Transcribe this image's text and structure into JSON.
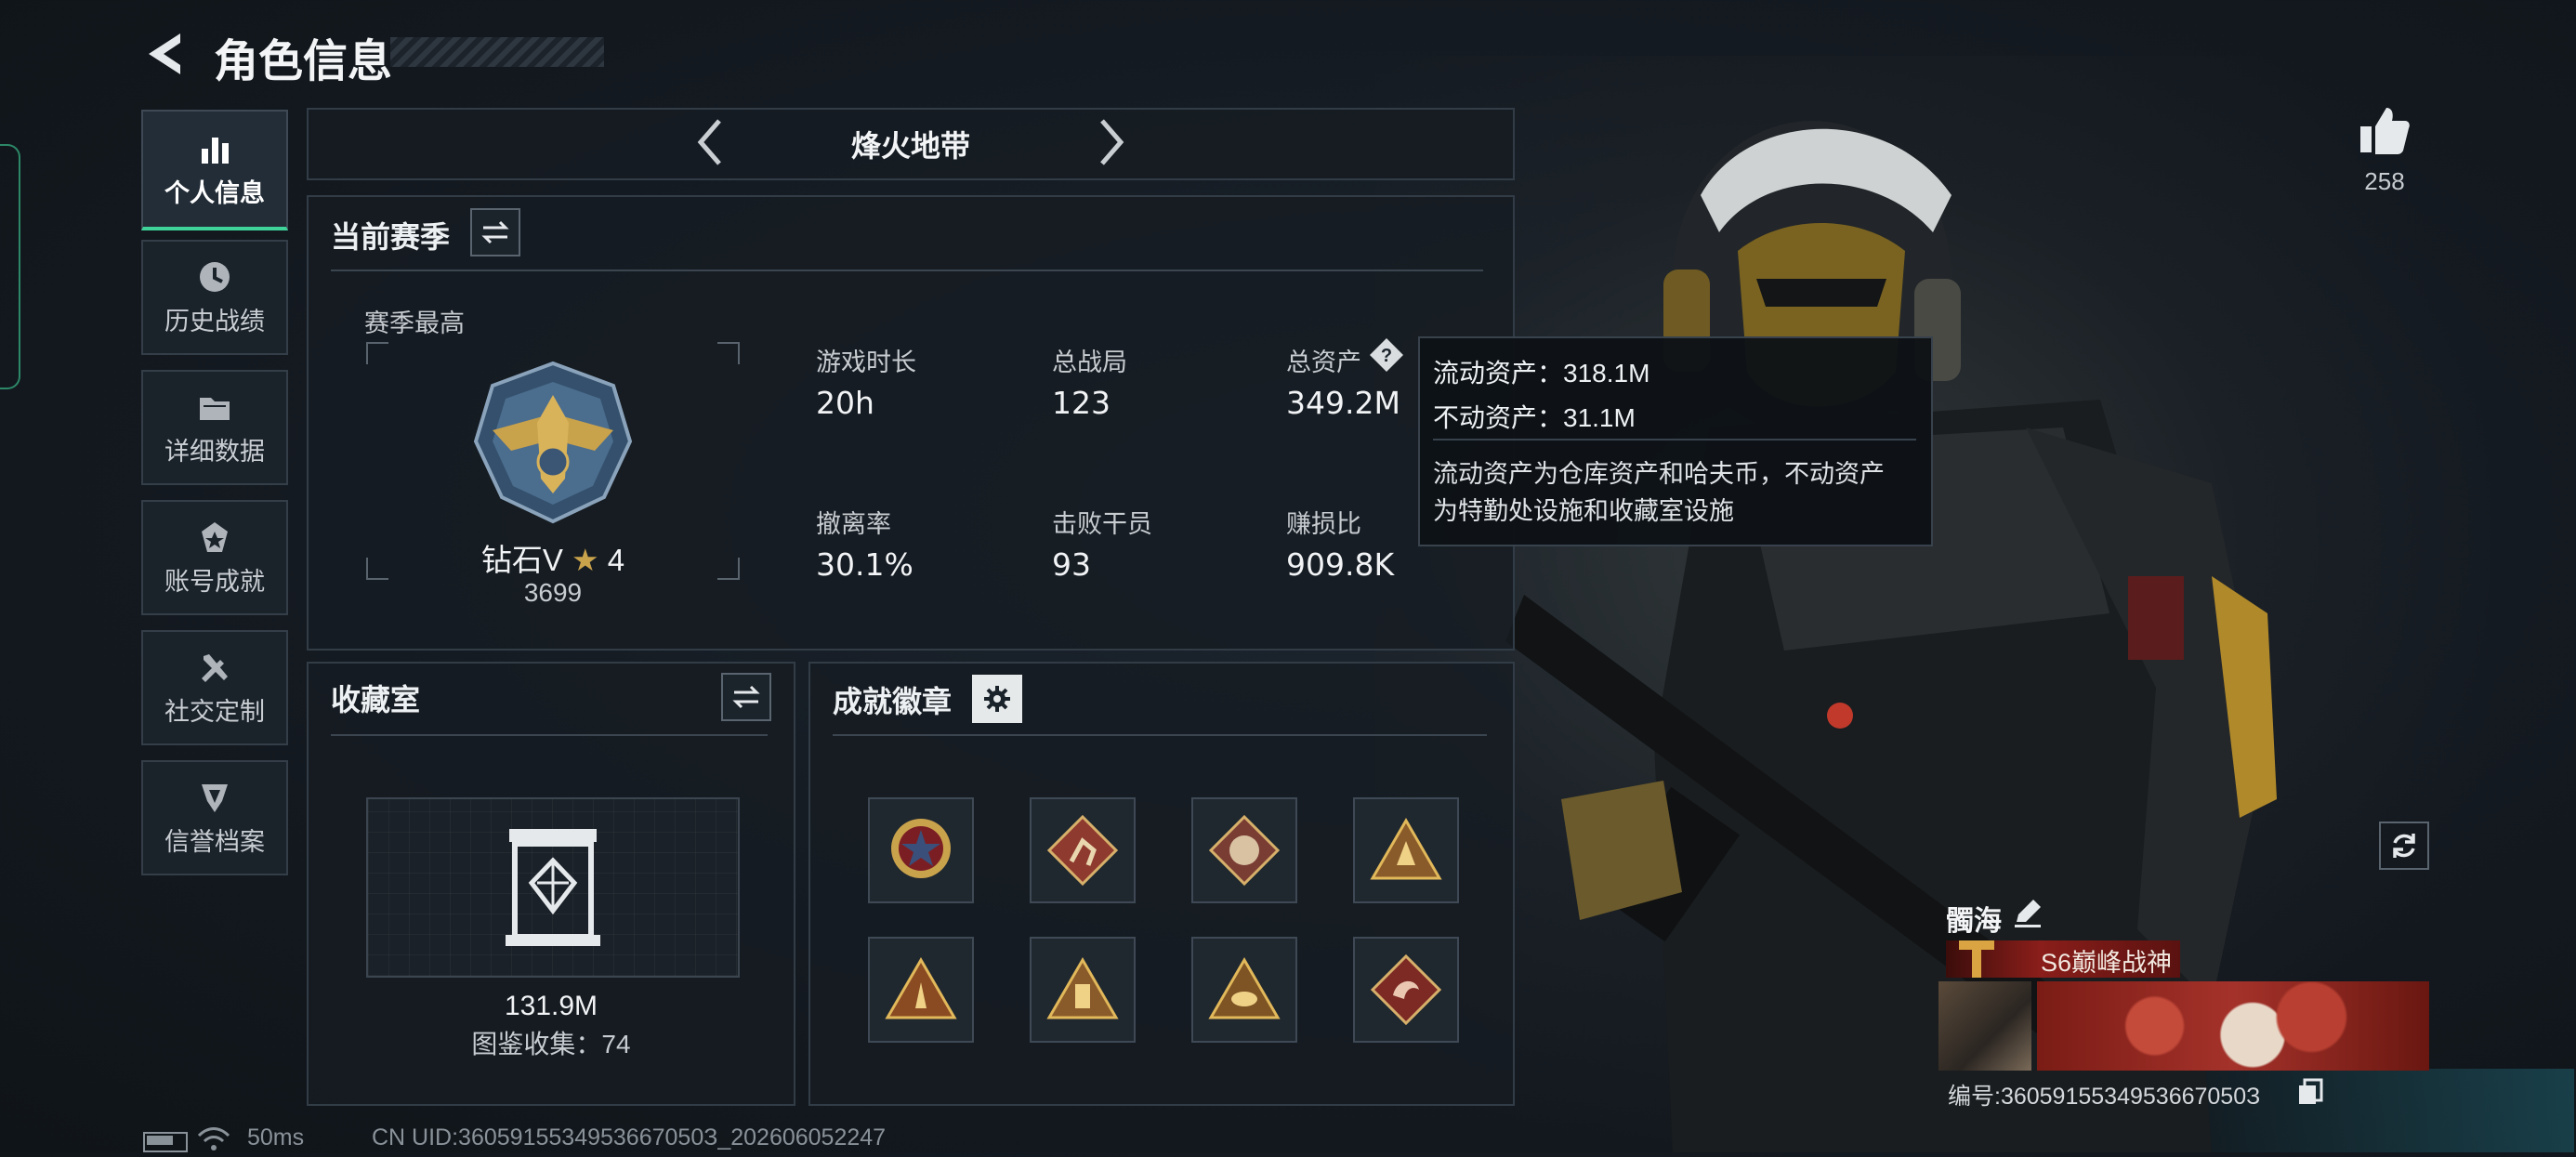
{
  "header": {
    "title": "角色信息"
  },
  "sidebar": {
    "items": [
      {
        "label": "个人信息",
        "icon": "bar-chart-icon",
        "active": true
      },
      {
        "label": "历史战绩",
        "icon": "history-clock-icon"
      },
      {
        "label": "详细数据",
        "icon": "folder-icon"
      },
      {
        "label": "账号成就",
        "icon": "achievement-icon"
      },
      {
        "label": "社交定制",
        "icon": "tools-icon"
      },
      {
        "label": "信誉档案",
        "icon": "shield-icon"
      }
    ]
  },
  "mode": {
    "title": "烽火地带"
  },
  "season": {
    "title": "当前赛季",
    "best_label": "赛季最高",
    "rank_name": "钻石V",
    "rank_stars": "4",
    "rank_score": "3699",
    "stats": [
      {
        "label": "游戏时长",
        "value": "20h"
      },
      {
        "label": "总战局",
        "value": "123"
      },
      {
        "label": "总资产",
        "value": "349.2M"
      },
      {
        "label": "撤离率",
        "value": "30.1%"
      },
      {
        "label": "击败干员",
        "value": "93"
      },
      {
        "label": "赚损比",
        "value": "909.8K"
      }
    ]
  },
  "tooltip": {
    "line1": "流动资产：318.1M",
    "line2": "不动资产：31.1M",
    "desc1": "流动资产为仓库资产和哈夫币，不动资产",
    "desc2": "为特勤处设施和收藏室设施"
  },
  "collection": {
    "title": "收藏室",
    "value": "131.9M",
    "catalog": "图鉴收集：74"
  },
  "achievements": {
    "title": "成就徽章",
    "badges": [
      "star-medal-icon",
      "runner-badge-icon",
      "beast-badge-icon",
      "warrior-badge-icon",
      "pyramid-badge-icon",
      "tower-badge-icon",
      "eye-badge-icon",
      "dragon-badge-icon"
    ]
  },
  "profile": {
    "likes": "258",
    "name": "髑海",
    "title": "S6巅峰战神",
    "id": "编号:3605915534953667050З"
  },
  "status": {
    "ping": "50ms",
    "uid": "CN UID:3605915534953667050З_202606052247"
  },
  "colors": {
    "accent": "#3fd39a",
    "tooltip_bg": "#0e1216",
    "title_red": "#8a1e1a"
  }
}
